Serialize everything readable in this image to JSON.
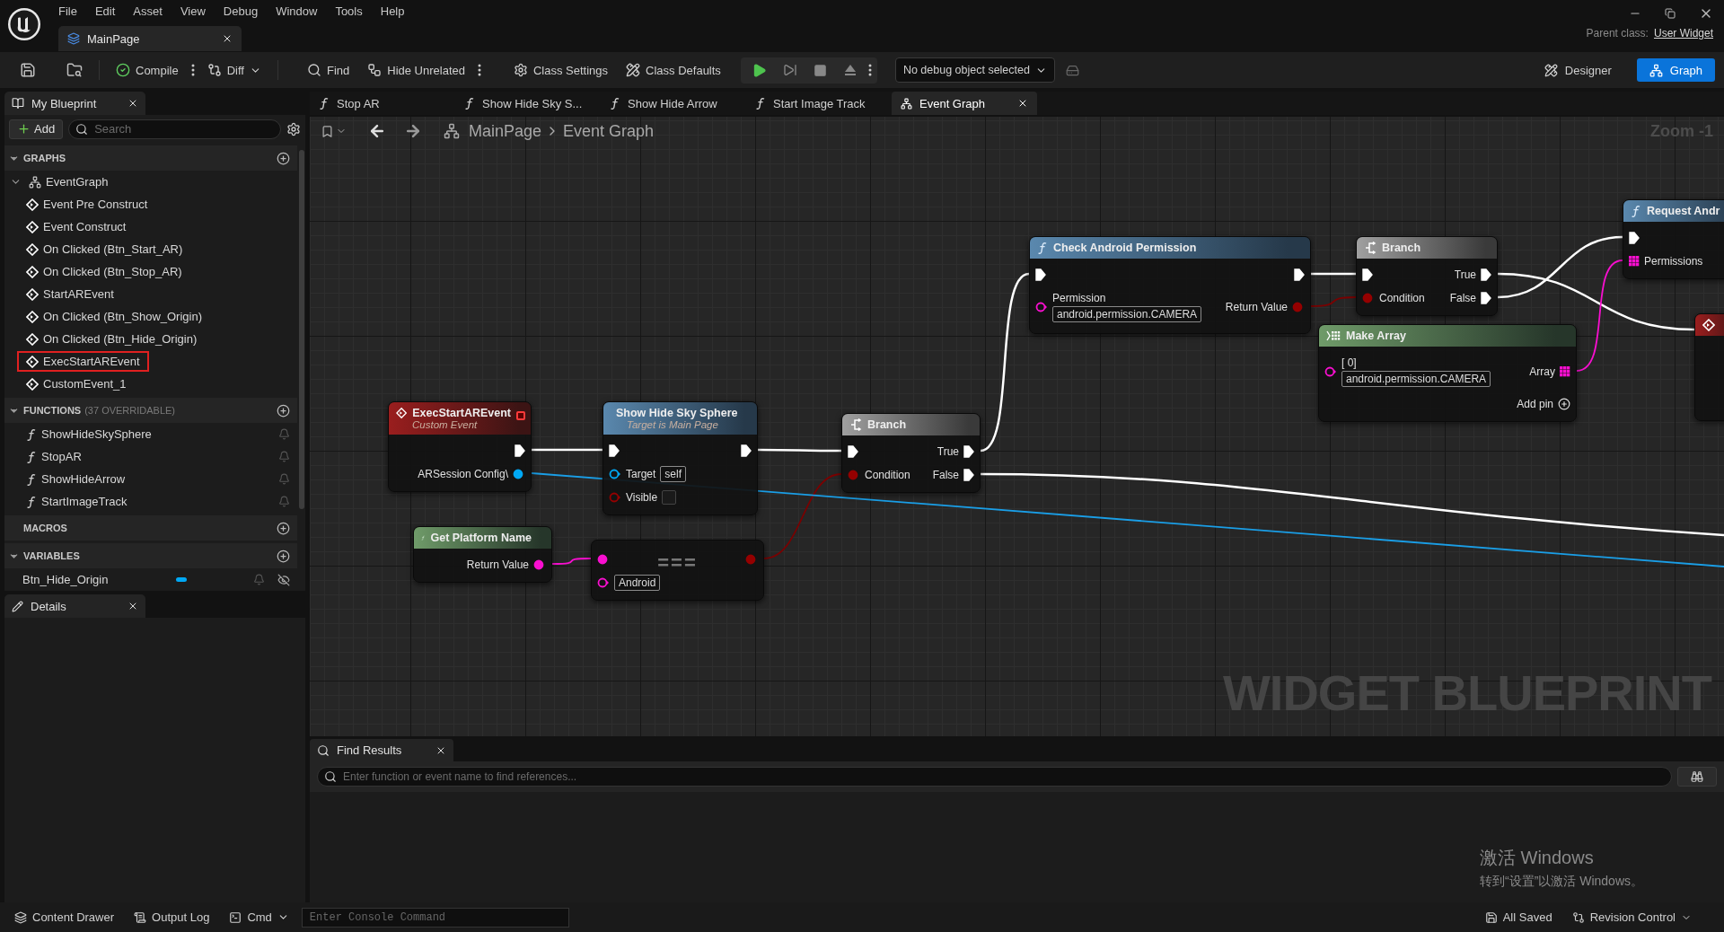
{
  "menu": [
    "File",
    "Edit",
    "Asset",
    "View",
    "Debug",
    "Window",
    "Tools",
    "Help"
  ],
  "document_tab": {
    "label": "MainPage"
  },
  "parent_class": {
    "label": "Parent class:",
    "value": "User Widget"
  },
  "toolbar": {
    "buttons": [
      {
        "label": "Compile"
      },
      {
        "label": "Diff"
      },
      {
        "label": "Find"
      },
      {
        "label": "Hide Unrelated"
      },
      {
        "label": "Class Settings"
      },
      {
        "label": "Class Defaults"
      }
    ],
    "debug_object": "No debug object selected",
    "modes": [
      {
        "label": "Designer",
        "selected": false
      },
      {
        "label": "Graph",
        "selected": true
      }
    ]
  },
  "my_blueprint": {
    "title": "My Blueprint",
    "add": "Add",
    "search_placeholder": "Search",
    "sections": [
      {
        "kind": "graphs",
        "title": "GRAPHS",
        "expanded": true,
        "items": [
          {
            "label": "EventGraph",
            "expanded": true,
            "children": [
              {
                "label": "Event Pre Construct",
                "highlighted": false
              },
              {
                "label": "Event Construct",
                "highlighted": false
              },
              {
                "label": "On Clicked (Btn_Start_AR)",
                "highlighted": false
              },
              {
                "label": "On Clicked (Btn_Stop_AR)",
                "highlighted": false
              },
              {
                "label": "StartAREvent",
                "highlighted": false
              },
              {
                "label": "On Clicked (Btn_Show_Origin)",
                "highlighted": false
              },
              {
                "label": "On Clicked (Btn_Hide_Origin)",
                "highlighted": false
              },
              {
                "label": "ExecStartAREvent",
                "highlighted": true
              },
              {
                "label": "CustomEvent_1",
                "highlighted": false
              }
            ]
          }
        ]
      },
      {
        "kind": "functions",
        "title": "FUNCTIONS",
        "note": "(37 OVERRIDABLE)",
        "expanded": true,
        "items": [
          {
            "label": "ShowHideSkySphere"
          },
          {
            "label": "StopAR"
          },
          {
            "label": "ShowHideArrow"
          },
          {
            "label": "StartImageTrack"
          }
        ]
      },
      {
        "title": "MACROS"
      },
      {
        "kind": "variables",
        "title": "VARIABLES",
        "expanded": true,
        "items": [
          {
            "label": "Btn_Hide_Origin",
            "color": "#00a8f4"
          }
        ]
      }
    ]
  },
  "details": {
    "title": "Details"
  },
  "graph_tabs": [
    {
      "label": "Stop AR",
      "kind": "function",
      "selected": false
    },
    {
      "label": "Show Hide Sky S...",
      "kind": "function",
      "selected": false
    },
    {
      "label": "Show Hide Arrow",
      "kind": "function",
      "selected": false
    },
    {
      "label": "Start Image Track",
      "kind": "function",
      "selected": false
    },
    {
      "label": "Event Graph",
      "kind": "graph",
      "selected": true
    }
  ],
  "breadcrumb": [
    "MainPage",
    "Event Graph"
  ],
  "zoom": "Zoom -1",
  "watermark": "WIDGET BLUEPRINT",
  "nodes": [
    {
      "kind": "event",
      "title": "ExecStartAREvent",
      "subtitle": "Custom Event",
      "rows": [
        {
          "right": {
            "kind": "exec",
            "connected": true
          }
        },
        {
          "right": {
            "kind": "object",
            "label": "ARSession Config\\",
            "connected": true
          }
        }
      ]
    },
    {
      "kind": "function",
      "title": "Show Hide Sky Sphere",
      "subtitle": "Target is Main Page",
      "rows": [
        {
          "left": {
            "kind": "exec",
            "connected": true
          },
          "right": {
            "kind": "exec",
            "connected": true
          }
        },
        {
          "left": {
            "kind": "object",
            "label": "Target",
            "value": "self",
            "connected": false
          }
        },
        {
          "left": {
            "kind": "bool",
            "label": "Visible",
            "checked": false,
            "connected": false
          }
        }
      ]
    },
    {
      "kind": "flow",
      "title": "Branch",
      "rows": [
        {
          "left": {
            "kind": "exec",
            "connected": true
          },
          "right": {
            "kind": "exec",
            "label": "True",
            "connected": true
          }
        },
        {
          "left": {
            "kind": "bool",
            "label": "Condition",
            "connected": true
          },
          "right": {
            "kind": "exec",
            "label": "False",
            "connected": true
          }
        }
      ]
    },
    {
      "kind": "pure",
      "title": "Get Platform Name",
      "rows": [
        {
          "right": {
            "kind": "string",
            "label": "Return Value",
            "connected": true
          }
        }
      ]
    },
    {
      "kind": "compact",
      "title": "===",
      "rows": [
        {
          "left": {
            "kind": "string",
            "connected": true
          },
          "right": {
            "kind": "bool",
            "connected": true
          }
        },
        {
          "left": {
            "kind": "string",
            "value": "Android",
            "connected": false
          }
        }
      ]
    },
    {
      "kind": "function",
      "title": "Check Android Permission",
      "rows": [
        {
          "left": {
            "kind": "exec",
            "connected": true
          },
          "right": {
            "kind": "exec",
            "connected": true
          }
        },
        {
          "left": {
            "kind": "string",
            "label": "Permission",
            "value": "android.permission.CAMERA",
            "connected": false
          },
          "right": {
            "kind": "bool",
            "label": "Return Value",
            "connected": true
          }
        }
      ]
    },
    {
      "kind": "flow",
      "title": "Branch",
      "rows": [
        {
          "left": {
            "kind": "exec",
            "connected": true
          },
          "right": {
            "kind": "exec",
            "label": "True",
            "connected": true
          }
        },
        {
          "left": {
            "kind": "bool",
            "label": "Condition",
            "connected": true
          },
          "right": {
            "kind": "exec",
            "label": "False",
            "connected": true
          }
        }
      ]
    },
    {
      "kind": "array",
      "title": "Make Array",
      "rows": [
        {
          "left": {
            "kind": "string",
            "label": "[ 0]",
            "value": "android.permission.CAMERA",
            "connected": false
          },
          "right": {
            "kind": "array",
            "label": "Array",
            "connected": true
          }
        },
        {
          "right": {
            "kind": "add",
            "label": "Add pin"
          }
        }
      ]
    },
    {
      "kind": "function",
      "title": "Request Andr",
      "rows": [
        {
          "left": {
            "kind": "exec",
            "connected": true
          }
        },
        {
          "left": {
            "kind": "array",
            "label": "Permissions",
            "connected": true
          }
        }
      ]
    },
    {
      "kind": "event"
    }
  ],
  "find_results": {
    "title": "Find Results",
    "placeholder": "Enter function or event name to find references..."
  },
  "os_notice": {
    "title": "激活 Windows",
    "hint": "转到“设置”以激活 Windows。"
  },
  "status_bar": {
    "content_drawer": "Content Drawer",
    "output_log": "Output Log",
    "cmd": "Cmd",
    "console_placeholder": "Enter Console Command",
    "saved": "All Saved",
    "revision_control": "Revision Control"
  }
}
